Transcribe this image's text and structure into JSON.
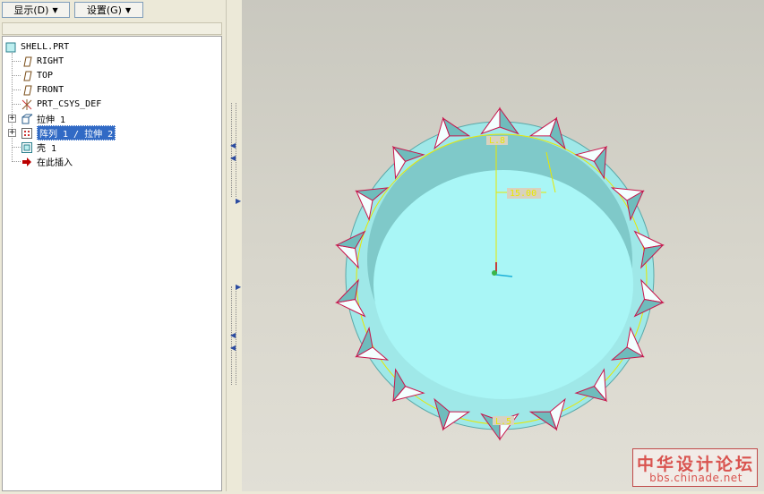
{
  "toolbar": {
    "display_label": "显示(D)",
    "settings_label": "设置(G)"
  },
  "tree": {
    "root": "SHELL.PRT",
    "items": [
      {
        "label": "RIGHT",
        "icon": "datum-plane-icon"
      },
      {
        "label": "TOP",
        "icon": "datum-plane-icon"
      },
      {
        "label": "FRONT",
        "icon": "datum-plane-icon"
      },
      {
        "label": "PRT_CSYS_DEF",
        "icon": "csys-icon"
      },
      {
        "label": "拉伸 1",
        "icon": "extrude-icon"
      },
      {
        "label": "阵列 1 / 拉伸 2",
        "icon": "pattern-icon",
        "selected": true
      },
      {
        "label": "壳 1",
        "icon": "shell-icon"
      },
      {
        "label": "在此插入",
        "icon": "insert-arrow-icon"
      }
    ]
  },
  "viewport": {
    "dimension_top": "L.8",
    "dimension_angle": "15.00",
    "dimension_bottom": "L.5",
    "model_color": "#a8f4f4",
    "edge_color": "#c8144b",
    "sketch_color": "#e8e800"
  },
  "watermark": {
    "title": "中华设计论坛",
    "url": "bbs.chinade.net"
  }
}
